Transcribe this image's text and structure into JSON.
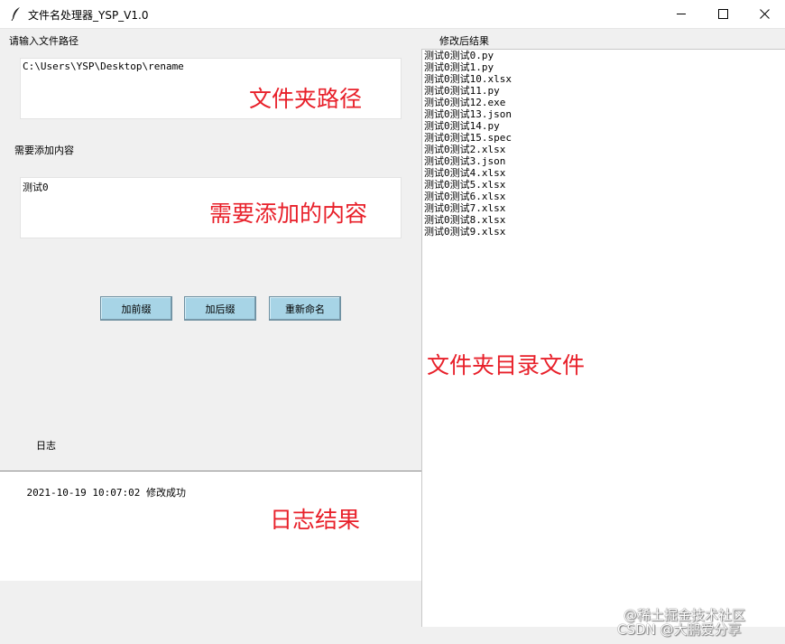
{
  "window": {
    "title": "文件名处理器_YSP_V1.0"
  },
  "labels": {
    "path": "请输入文件路径",
    "content": "需要添加内容",
    "log": "日志",
    "result": "修改后结果"
  },
  "inputs": {
    "path_value": "C:\\Users\\YSP\\Desktop\\rename",
    "content_value": "测试0"
  },
  "buttons": {
    "prefix": "加前缀",
    "suffix": "加后缀",
    "rename": "重新命名"
  },
  "results": [
    "测试0测试0.py",
    "测试0测试1.py",
    "测试0测试10.xlsx",
    "测试0测试11.py",
    "测试0测试12.exe",
    "测试0测试13.json",
    "测试0测试14.py",
    "测试0测试15.spec",
    "测试0测试2.xlsx",
    "测试0测试3.json",
    "测试0测试4.xlsx",
    "测试0测试5.xlsx",
    "测试0测试6.xlsx",
    "测试0测试7.xlsx",
    "测试0测试8.xlsx",
    "测试0测试9.xlsx"
  ],
  "log": {
    "entry": "2021-10-19 10:07:02 修改成功"
  },
  "annotations": {
    "folder_path": "文件夹路径",
    "content_to_add": "需要添加的内容",
    "folder_files": "文件夹目录文件",
    "log_result": "日志结果"
  },
  "watermark": {
    "line1": "@稀土掘金技术社区",
    "line2": "CSDN @大鹏爱分享"
  },
  "colors": {
    "annotation": "#e8202a",
    "button": "#a7d4e6",
    "window_bg": "#f0f0f0"
  }
}
